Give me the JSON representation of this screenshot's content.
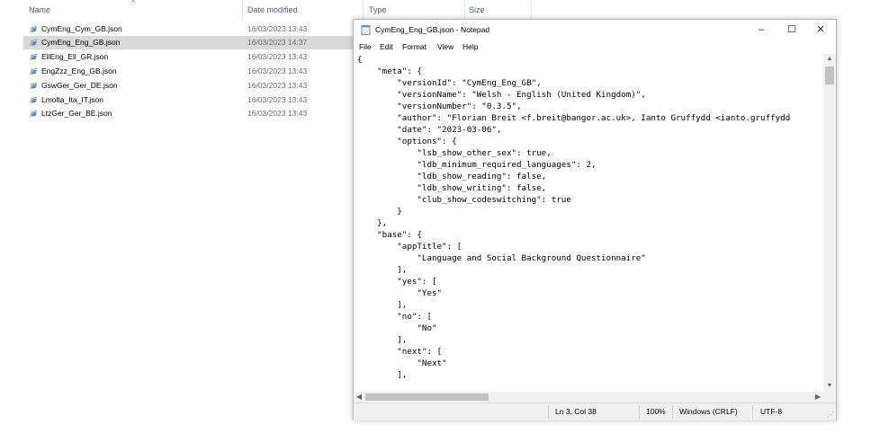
{
  "explorer": {
    "columns": {
      "name": "Name",
      "date_modified": "Date modified",
      "type": "Type",
      "size": "Size"
    },
    "files": [
      {
        "name": "CymEng_Cym_GB.json",
        "date": "16/03/2023 13:43",
        "selected": false
      },
      {
        "name": "CymEng_Eng_GB.json",
        "date": "16/03/2023 14:37",
        "selected": true
      },
      {
        "name": "EllEng_Ell_GR.json",
        "date": "16/03/2023 13:43",
        "selected": false
      },
      {
        "name": "EngZzz_Eng_GB.json",
        "date": "16/03/2023 13:43",
        "selected": false
      },
      {
        "name": "GswGer_Ger_DE.json",
        "date": "16/03/2023 13:43",
        "selected": false
      },
      {
        "name": "Lmolta_Ita_IT.json",
        "date": "16/03/2023 13:43",
        "selected": false
      },
      {
        "name": "LtzGer_Ger_BE.json",
        "date": "16/03/2023 13:43",
        "selected": false
      }
    ]
  },
  "notepad": {
    "title": "CymEng_Eng_GB.json - Notepad",
    "window_controls": {
      "minimize": "–",
      "maximize": "☐",
      "close": "✕"
    },
    "menu": [
      "File",
      "Edit",
      "Format",
      "View",
      "Help"
    ],
    "content_lines": [
      "{",
      "    \"meta\": {",
      "        \"versionId\": \"CymEng_Eng_GB\",",
      "        \"versionName\": \"Welsh - English (United Kingdom)\",",
      "        \"versionNumber\": \"0.3.5\",",
      "        \"author\": \"Florian Breit <f.breit@bangor.ac.uk>, Ianto Gruffydd <ianto.gruffydd",
      "        \"date\": \"2023-03-06\",",
      "        \"options\": {",
      "            \"lsb_show_other_sex\": true,",
      "            \"ldb_minimum_required_languages\": 2,",
      "            \"ldb_show_reading\": false,",
      "            \"ldb_show_writing\": false,",
      "            \"club_show_codeswitching\": true",
      "        }",
      "    },",
      "    \"base\": {",
      "        \"appTitle\": [",
      "            \"Language and Social Background Questionnaire\"",
      "        ],",
      "        \"yes\": [",
      "            \"Yes\"",
      "        ],",
      "        \"no\": [",
      "            \"No\"",
      "        ],",
      "        \"next\": [",
      "            \"Next\"",
      "        ],"
    ],
    "status": {
      "position": "Ln 3, Col 38",
      "zoom": "100%",
      "line_ending": "Windows (CRLF)",
      "encoding": "UTF-8"
    },
    "icons": {
      "app": "notepad-icon",
      "file": "json-file-icon"
    }
  },
  "colors": {
    "selection": "#d9d9d9",
    "header_text": "#4c607a",
    "status_bar": "#f0f0f0"
  }
}
